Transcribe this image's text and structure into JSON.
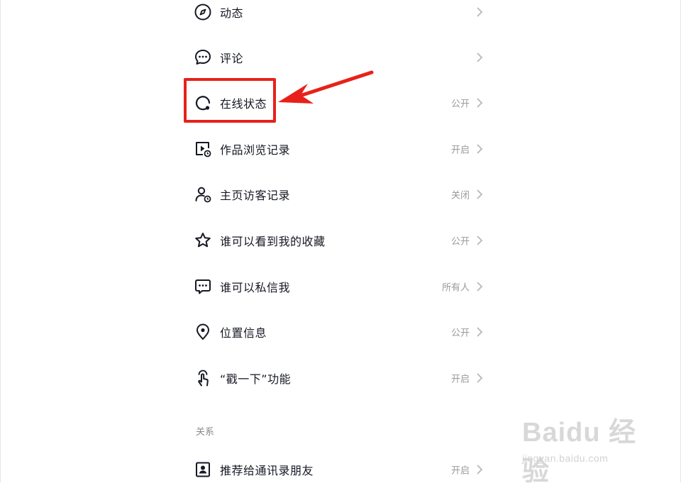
{
  "privacy_settings": {
    "items": [
      {
        "label": "动态",
        "value": ""
      },
      {
        "label": "评论",
        "value": ""
      },
      {
        "label": "在线状态",
        "value": "公开"
      },
      {
        "label": "作品浏览记录",
        "value": "开启"
      },
      {
        "label": "主页访客记录",
        "value": "关闭"
      },
      {
        "label": "谁可以看到我的收藏",
        "value": "公开"
      },
      {
        "label": "谁可以私信我",
        "value": "所有人"
      },
      {
        "label": "位置信息",
        "value": "公开"
      },
      {
        "label": "“戳一下”功能",
        "value": "开启"
      }
    ]
  },
  "relations_section": {
    "header": "关系",
    "items": [
      {
        "label": "推荐给通讯录朋友",
        "value": "开启"
      }
    ]
  },
  "watermark": {
    "logo_text": "Baidu 经验",
    "url": "jingyan.baidu.com"
  },
  "colors": {
    "highlight": "#e8201c",
    "text_primary": "#161823",
    "text_secondary": "#9a9a9f"
  }
}
